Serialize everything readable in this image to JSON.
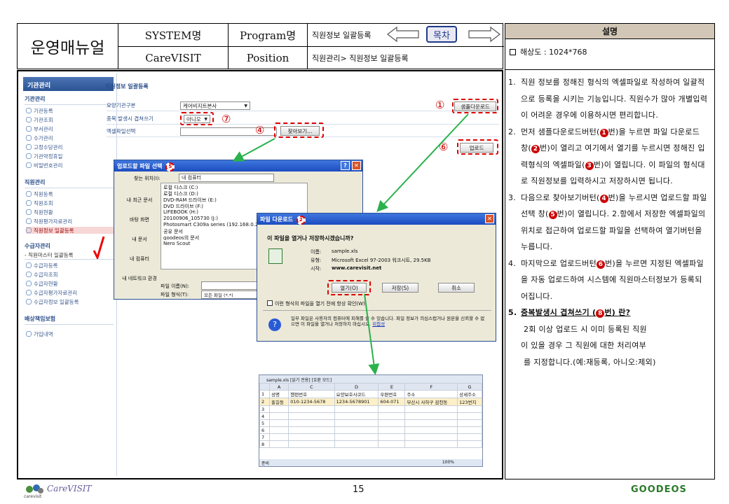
{
  "header": {
    "manual_title": "운영매뉴얼",
    "system_label": "SYSTEM명",
    "program_label": "Program명",
    "program_value": "직원정보 일괄등록",
    "system_value": "CareVISIT",
    "position_label": "Position",
    "position_value": "직원관리> 직원정보 일괄등록",
    "toc_label": "목차"
  },
  "panel": {
    "title": "설명",
    "resolution": "해상도 : 1024*768",
    "items": [
      {
        "num": "1.",
        "text": "직원 정보를 정해진 형식의 엑셀파일로 작성하여 일괄적으로 등록을 시키는 기능입니다. 직원수가 많아 개별입력이 어려운 경우에 이용하시면 편리합니다."
      },
      {
        "num": "2.",
        "text_a": "먼저 샘플다운로드버턴(",
        "c1": "1",
        "text_b": "번)을 누르면 파일 다운로드 창(",
        "c2": "2",
        "text_c": "번)이 열리고 여기에서 열기를 누르시면 정해진 입력형식의 엑셀파일(",
        "c3": "3",
        "text_d": "번)이 열립니다. 이 파일의 형식대로 직원정보를 입력하시고 저장하시면 됩니다."
      },
      {
        "num": "3.",
        "text_a": "다음으로 찾아보기버턴(",
        "c1": "4",
        "text_b": "번)을 누르시면 업로드할 파일선택 창(",
        "c2": "5",
        "text_c": "번)이 열립니다. 2.항에서 저장한 엑셀파일의 위치로 접근하여 업로드할 파일을 선택하여 열기버턴을 누릅니다."
      },
      {
        "num": "4.",
        "text_a": "마지막으로 업로드버턴",
        "c1": "6",
        "text_b": "번)을 누르면 지정된 엑셀파일을 자동 업로드하여 시스템에 직원마스터정보가 등록되어집니다."
      },
      {
        "num": "5.",
        "head_a": "중복발생시 겹쳐쓰기 (",
        "c1": "8",
        "head_b": "번) 란?",
        "lines": [
          "2회 이상 업로드 시 이미 등록된 직원",
          "이 있을 경우 그 직원에 대한 처리여부",
          "를 지정합니다.(예:재등록, 아니오:제외)"
        ]
      }
    ]
  },
  "sidebar": {
    "title": "기관관리",
    "sections": [
      {
        "name": "기관관리",
        "items": [
          "기관등록",
          "기관조회",
          "부서관리",
          "수가관리",
          "고정수당관리",
          "기관약정휴일",
          "비밀번호관리"
        ]
      },
      {
        "name": "직원관리",
        "items": [
          "직원등록",
          "직원조회",
          "직원현황",
          "직원평가자료관리",
          "직원정보 일괄등록"
        ]
      },
      {
        "name": "수급자관리",
        "sub": "- 직원마스터 일괄등록",
        "items": [
          "수급자등록",
          "수급자조회",
          "수급자현황",
          "수급자평가자료관리",
          "수급자정보 일괄등록"
        ]
      },
      {
        "name": "배상책임보험",
        "items": [
          "가입내역"
        ]
      }
    ]
  },
  "form": {
    "title": "직원정보 일괄등록",
    "row1_label": "요양기관구분",
    "row1_value": "케어비지트본사",
    "row2_label": "중복 발생시 겹쳐쓰기",
    "row2_value": "아니오",
    "row3_label": "엑셀파일선택",
    "browse_btn": "찾아보기...",
    "sample_btn": "샘플다운로드",
    "upload_btn": "업로드",
    "markers": {
      "m1": "①",
      "m4": "④",
      "m6": "⑥",
      "m7": "⑦",
      "m3": "③"
    }
  },
  "upload_dialog": {
    "title": "업로드할 파일 선택",
    "marker": "5",
    "lookin_label": "찾는 위치(I):",
    "lookin_value": "내 컴퓨터",
    "places": [
      "내 최근 문서",
      "바탕 화면",
      "내 문서",
      "내 컴퓨터",
      "내 네트워크 환경"
    ],
    "files": [
      "로컬 디스크 (C:)",
      "로컬 디스크 (D:)",
      "DVD-RAM 드라이브 (E:)",
      "DVD 드라이브 (F:)",
      "LIFEBOOK (H:)",
      "20100906_105730 (J:)",
      "Photosmart C309a series (192.168.0.27) (",
      "공유 문서",
      "goodeos의 문서",
      "Nero Scout"
    ],
    "filename_label": "파일 이름(N):",
    "filetype_label": "파일 형식(T):",
    "filetype_value": "모든 파일 (*.*)"
  },
  "download_dialog": {
    "title": "파일 다운로드",
    "marker": "2",
    "question": "이 파일을 열거나 저장하시겠습니까?",
    "name_label": "이름:",
    "name_value": "sample.xls",
    "type_label": "유형:",
    "type_value": "Microsoft Excel 97-2003 워크시트, 29.5KB",
    "from_label": "시작:",
    "from_value": "www.carevisit.net",
    "open_btn": "열기(O)",
    "save_btn": "저장(S)",
    "cancel_btn": "취소",
    "check_label": "이런 형식의 파일을 열기 전에 항상 확인(W)",
    "warning": "일부 파일은 사용자의 컴퓨터에 피해를 줄 수 있습니다. 파일 정보가 의심스럽거나 원본을 신뢰할 수 없으면 이 파일을 열거나 저장하지 마십시오.",
    "risk_link": "위험성"
  },
  "sheet": {
    "title": "sample.xls [읽기 전용] [호환 모드]",
    "cols": [
      "",
      "A",
      "C",
      "D",
      "E",
      "F",
      "G"
    ],
    "header_row": [
      "1",
      "성명",
      "핸펀번호",
      "요양보호사코드",
      "우편번호",
      "주소",
      "상세주소"
    ],
    "data_row": [
      "2",
      "홍길동",
      "010-1234-5678",
      "1234-5678901",
      "604-071",
      "부산시 사하구 감천동",
      "123번지"
    ],
    "empty_rows": [
      "3",
      "4",
      "5",
      "6",
      "7",
      "8"
    ],
    "status": "준비",
    "zoom": "100%"
  },
  "footer": {
    "page": "15",
    "left_logo": "CareVISIT",
    "left_sub": "carevisit",
    "right_logo": "GOODEOS"
  }
}
